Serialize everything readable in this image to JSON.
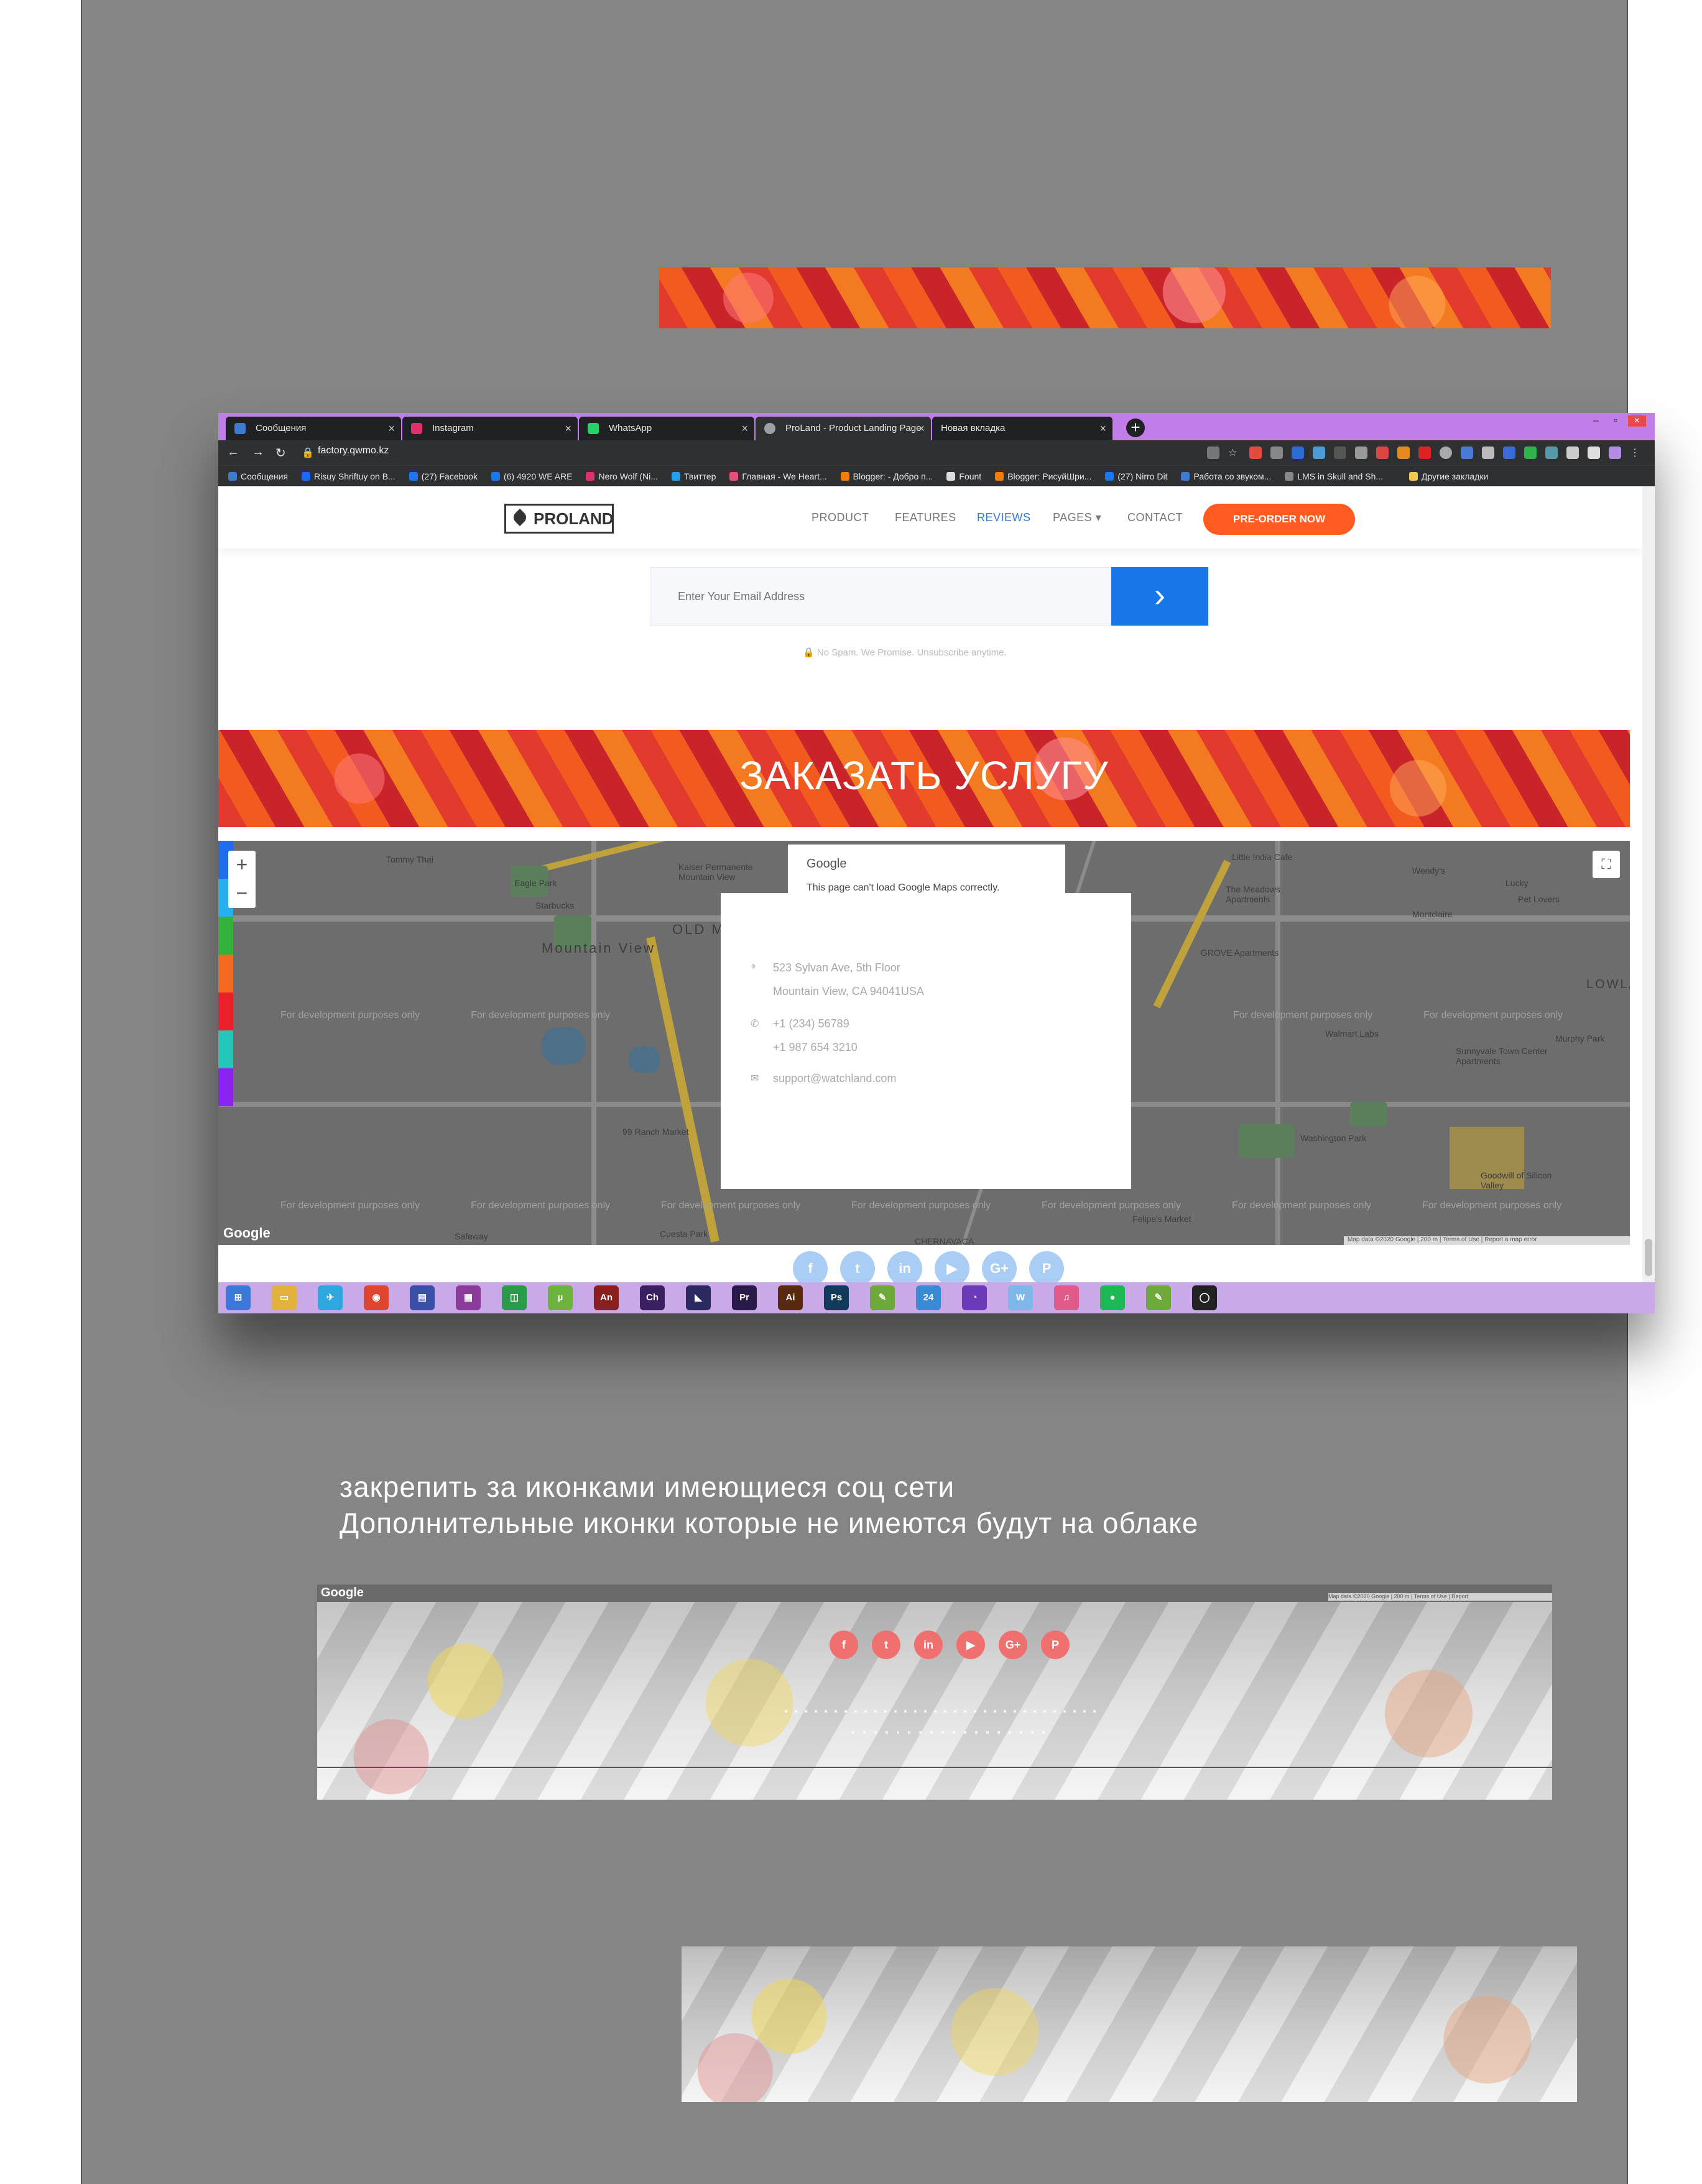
{
  "browser": {
    "tabs": [
      {
        "label": "Сообщения",
        "color": "#3b7bd4"
      },
      {
        "label": "Instagram",
        "color": "#e1306c"
      },
      {
        "label": "WhatsApp",
        "color": "#25d366"
      },
      {
        "label": "ProLand - Product Landing Page",
        "color": "#9aa0a6"
      },
      {
        "label": "Новая вкладка",
        "color": "#9aa0a6"
      }
    ],
    "url": "factory.qwmo.kz",
    "bookmarks": [
      "Сообщения",
      "Risuy Shriftuy on B...",
      "(27) Facebook",
      "(6) 4920 WE ARE",
      "Nero Wolf (Ni...",
      "Твиттер",
      "Главная - We Heart...",
      "Blogger: - Добро п...",
      "Fount",
      "Blogger: РисуйШри...",
      "(27) Nirro Dit",
      "Работа со звуком...",
      "LMS in Skull and Sh...",
      "Другие закладки"
    ]
  },
  "site": {
    "logo": "PROLAND",
    "menu": [
      "PRODUCT",
      "FEATURES",
      "REVIEWS",
      "PAGES ▾",
      "CONTACT"
    ],
    "active_menu": "REVIEWS",
    "cta": "PRE-ORDER NOW",
    "email_placeholder": "Enter Your Email Address",
    "send_arrow": "›",
    "nospam": "No Spam. We Promise. Unsubscribe anytime.",
    "banner_title": "ЗАКАЗАТЬ УСЛУГУ",
    "map": {
      "error_brand": "Google",
      "error_text": "This page can't load Google Maps correctly.",
      "dev_watermark": "For development purposes only",
      "logo": "Google",
      "footer": "Map data ©2020 Google | 200 m | Terms of Use | Report a map error",
      "address1": "523 Sylvan Ave, 5th Floor",
      "address2": "Mountain View, CA 94041USA",
      "phone1": "+1 (234) 56789",
      "phone2": "+1 987 654 3210",
      "email": "support@watchland.com",
      "labels": [
        "Tommy Thai",
        "Eagle Park",
        "Starbucks",
        "Kaiser Permanente Mountain View",
        "Mountain View",
        "OLD M",
        "99 Ranch Market",
        "Little India Cafe",
        "The Meadows Apartments",
        "Wendy's",
        "Lucky",
        "Pet Lovers",
        "Montclaire",
        "GROVE Apartments",
        "LOWLA",
        "Walmart Labs",
        "Murphy Park",
        "Sunnyvale Town Center Apartments",
        "Washington Park",
        "Goodwill of Silicon Valley",
        "Felipe's Market",
        "Cuesta Park",
        "CHERNAVACA",
        "Safeway"
      ]
    },
    "social": [
      "f",
      "t",
      "in",
      "▶",
      "G+",
      "P"
    ]
  },
  "taskbar": {
    "apps": [
      {
        "label": "⊞",
        "color": "#3b78d8"
      },
      {
        "label": "▭",
        "color": "#e2b23c"
      },
      {
        "label": "✈",
        "color": "#2ea6de"
      },
      {
        "label": "◉",
        "color": "#e0452f"
      },
      {
        "label": "▤",
        "color": "#3a4fa8"
      },
      {
        "label": "▦",
        "color": "#8a3b9c"
      },
      {
        "label": "◫",
        "color": "#2a9a4b"
      },
      {
        "label": "µ",
        "color": "#6bb33e"
      },
      {
        "label": "An",
        "color": "#8a1f1f"
      },
      {
        "label": "Ch",
        "color": "#3a2060"
      },
      {
        "label": "◣",
        "color": "#2a2a60"
      },
      {
        "label": "Pr",
        "color": "#2a1a4a"
      },
      {
        "label": "Ai",
        "color": "#5a2a10"
      },
      {
        "label": "Ps",
        "color": "#0f3a5a"
      },
      {
        "label": "✎",
        "color": "#6fa83b"
      },
      {
        "label": "24",
        "color": "#3a8ad4"
      },
      {
        "label": "◔",
        "color": "#6a3ab8"
      },
      {
        "label": "W",
        "color": "#7fb7e8"
      },
      {
        "label": "♫",
        "color": "#e05a8a"
      },
      {
        "label": "●",
        "color": "#1db954"
      },
      {
        "label": "✎",
        "color": "#6fa83b"
      },
      {
        "label": "◯",
        "color": "#222222"
      }
    ]
  },
  "notes": {
    "line1": "закрепить за иконками имеющиеся соц сети",
    "line2": "Дополнительные иконки которые не имеются будут на облаке"
  },
  "crop": {
    "google": "Google",
    "footer": "Map data ©2020 Google | 200 m | Terms of Use | Report",
    "social": [
      "f",
      "t",
      "in",
      "▶",
      "G+",
      "P"
    ]
  }
}
